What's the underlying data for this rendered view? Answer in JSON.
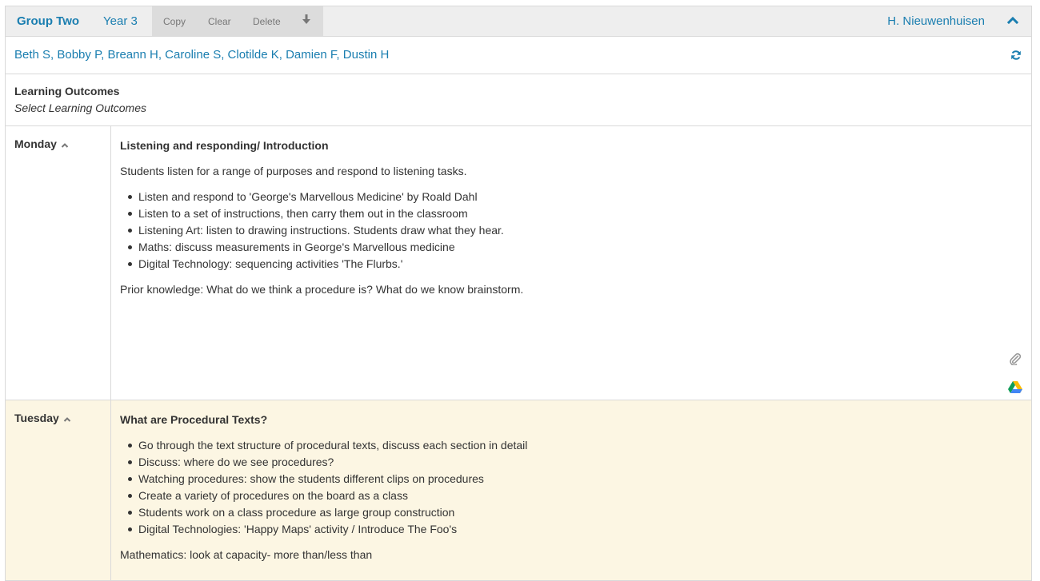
{
  "header": {
    "group_name": "Group Two",
    "year_level": "Year 3",
    "copy_label": "Copy",
    "clear_label": "Clear",
    "delete_label": "Delete",
    "teacher": "H. Nieuwenhuisen"
  },
  "students": {
    "list": "Beth S, Bobby P, Breann H, Caroline S, Clotilde K, Damien F, Dustin H"
  },
  "outcomes": {
    "title": "Learning Outcomes",
    "placeholder": "Select Learning Outcomes"
  },
  "days": [
    {
      "label": "Monday",
      "title": "Listening and responding/ Introduction",
      "intro": "Students listen for a range of purposes and respond to listening tasks.",
      "items": [
        "Listen and respond to 'George's Marvellous Medicine' by Roald Dahl",
        "Listen to a set of instructions, then carry them out in the classroom",
        "Listening Art: listen to drawing instructions. Students draw what they hear.",
        "Maths: discuss measurements in George's Marvellous medicine",
        "Digital Technology: sequencing activities 'The Flurbs.'"
      ],
      "outro": "Prior knowledge: What do we think a procedure is? What do we know brainstorm."
    },
    {
      "label": "Tuesday",
      "title": "What are Procedural Texts?",
      "items": [
        "Go through the text structure of procedural texts, discuss each section in detail",
        "Discuss: where do we see procedures?",
        "Watching procedures: show the students different clips on procedures",
        "Create a variety of procedures on the board as a class",
        "Students work on a class procedure as large group construction",
        "Digital Technologies: 'Happy Maps' activity / Introduce The Foo's"
      ],
      "outro": "Mathematics: look at capacity- more than/less than"
    }
  ],
  "icons": {
    "download": "download-icon",
    "collapse": "chevron-up-icon",
    "refresh": "refresh-icon",
    "attach": "paperclip-icon",
    "drive": "google-drive-icon"
  },
  "colors": {
    "link": "#1a7eb0",
    "toolbar_bg": "#eeeeee",
    "action_bg": "#dcdcdc",
    "tuesday_bg": "#fcf6e3",
    "border": "#d9d9d9"
  }
}
